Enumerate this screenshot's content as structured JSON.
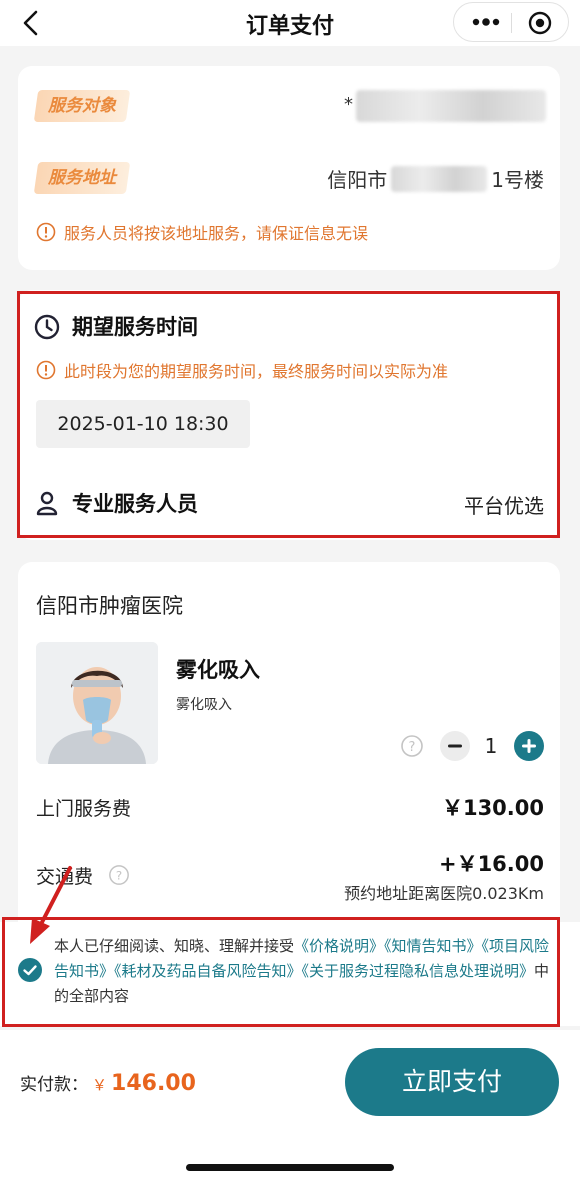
{
  "nav": {
    "title": "订单支付"
  },
  "service_card": {
    "target_label": "服务对象",
    "target_value_prefix": "*",
    "address_label": "服务地址",
    "address_prefix": "信阳市",
    "address_suffix": "1号楼",
    "notice": "服务人员将按该地址服务，请保证信息无误"
  },
  "time_card": {
    "title": "期望服务时间",
    "notice": "此时段为您的期望服务时间，最终服务时间以实际为准",
    "time_value": "2025-01-10 18:30",
    "staff_label": "专业服务人员",
    "staff_value": "平台优选"
  },
  "order_card": {
    "hospital": "信阳市肿瘤医院",
    "product_name": "雾化吸入",
    "product_sub": "雾化吸入",
    "quantity": "1",
    "visit_fee_label": "上门服务费",
    "visit_fee_value": "￥130.00",
    "transport_label": "交通费",
    "transport_value": "+￥16.00",
    "distance_note": "预约地址距离医院0.023Km"
  },
  "agreement": {
    "text_start": "本人已仔细阅读、知晓、理解并接受",
    "link1": "《价格说明》",
    "link2": "《知情告知书》",
    "link3": "《项目风险告知书》",
    "link4": "《耗材及药品自备风险告知》",
    "link5": "《关于服务过程隐私信息处理说明》",
    "text_end": "中的全部内容"
  },
  "footer": {
    "total_label": "实付款：",
    "currency": "￥",
    "total_value": "146.00",
    "pay_button": "立即支付"
  },
  "colors": {
    "accent_teal": "#1c7a8a",
    "orange": "#e0762f",
    "price_orange": "#e8641d",
    "annotation_red": "#d0201f"
  }
}
